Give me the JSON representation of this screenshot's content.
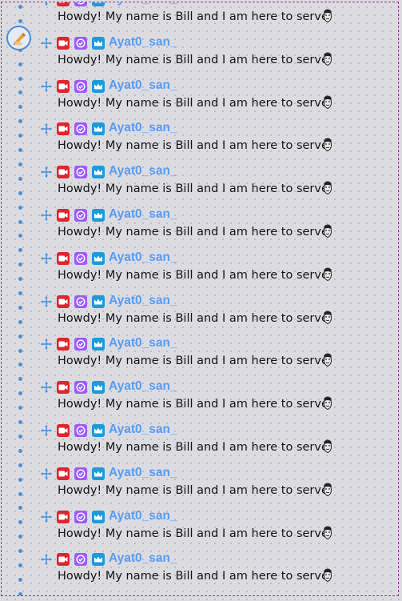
{
  "chat": {
    "messages": [
      {
        "username": "Ayat0_san_",
        "text": "Howdy! My name is Bill and I am here to serve"
      },
      {
        "username": "Ayat0_san_",
        "text": "Howdy! My name is Bill and I am here to serve"
      },
      {
        "username": "Ayat0_san_",
        "text": "Howdy! My name is Bill and I am here to serve"
      },
      {
        "username": "Ayat0_san_",
        "text": "Howdy! My name is Bill and I am here to serve"
      },
      {
        "username": "Ayat0_san_",
        "text": "Howdy! My name is Bill and I am here to serve"
      },
      {
        "username": "Ayat0_san_",
        "text": "Howdy! My name is Bill and I am here to serve"
      },
      {
        "username": "Ayat0_san_",
        "text": "Howdy! My name is Bill and I am here to serve"
      },
      {
        "username": "Ayat0_san_",
        "text": "Howdy! My name is Bill and I am here to serve"
      },
      {
        "username": "Ayat0_san_",
        "text": "Howdy! My name is Bill and I am here to serve"
      },
      {
        "username": "Ayat0_san_",
        "text": "Howdy! My name is Bill and I am here to serve"
      },
      {
        "username": "Ayat0_san_",
        "text": "Howdy! My name is Bill and I am here to serve"
      },
      {
        "username": "Ayat0_san_",
        "text": "Howdy! My name is Bill and I am here to serve"
      },
      {
        "username": "Ayat0_san_",
        "text": "Howdy! My name is Bill and I am here to serve"
      },
      {
        "username": "Ayat0_san_",
        "text": "Howdy! My name is Bill and I am here to serve"
      }
    ]
  },
  "badges": [
    {
      "icon": "video-camera-icon",
      "color": "#e0242c"
    },
    {
      "icon": "verified-check-icon",
      "color": "#9b5cf5"
    },
    {
      "icon": "crown-icon",
      "color": "#1c9bd9"
    }
  ],
  "icons": {
    "edit": "edit-hand-icon",
    "move": "move-handle-icon",
    "emote": "bill-face-emote-icon"
  },
  "colors": {
    "username": "#5a9cf0",
    "accent": "#4b8fd6",
    "frame_border": "#8a3c8a"
  }
}
